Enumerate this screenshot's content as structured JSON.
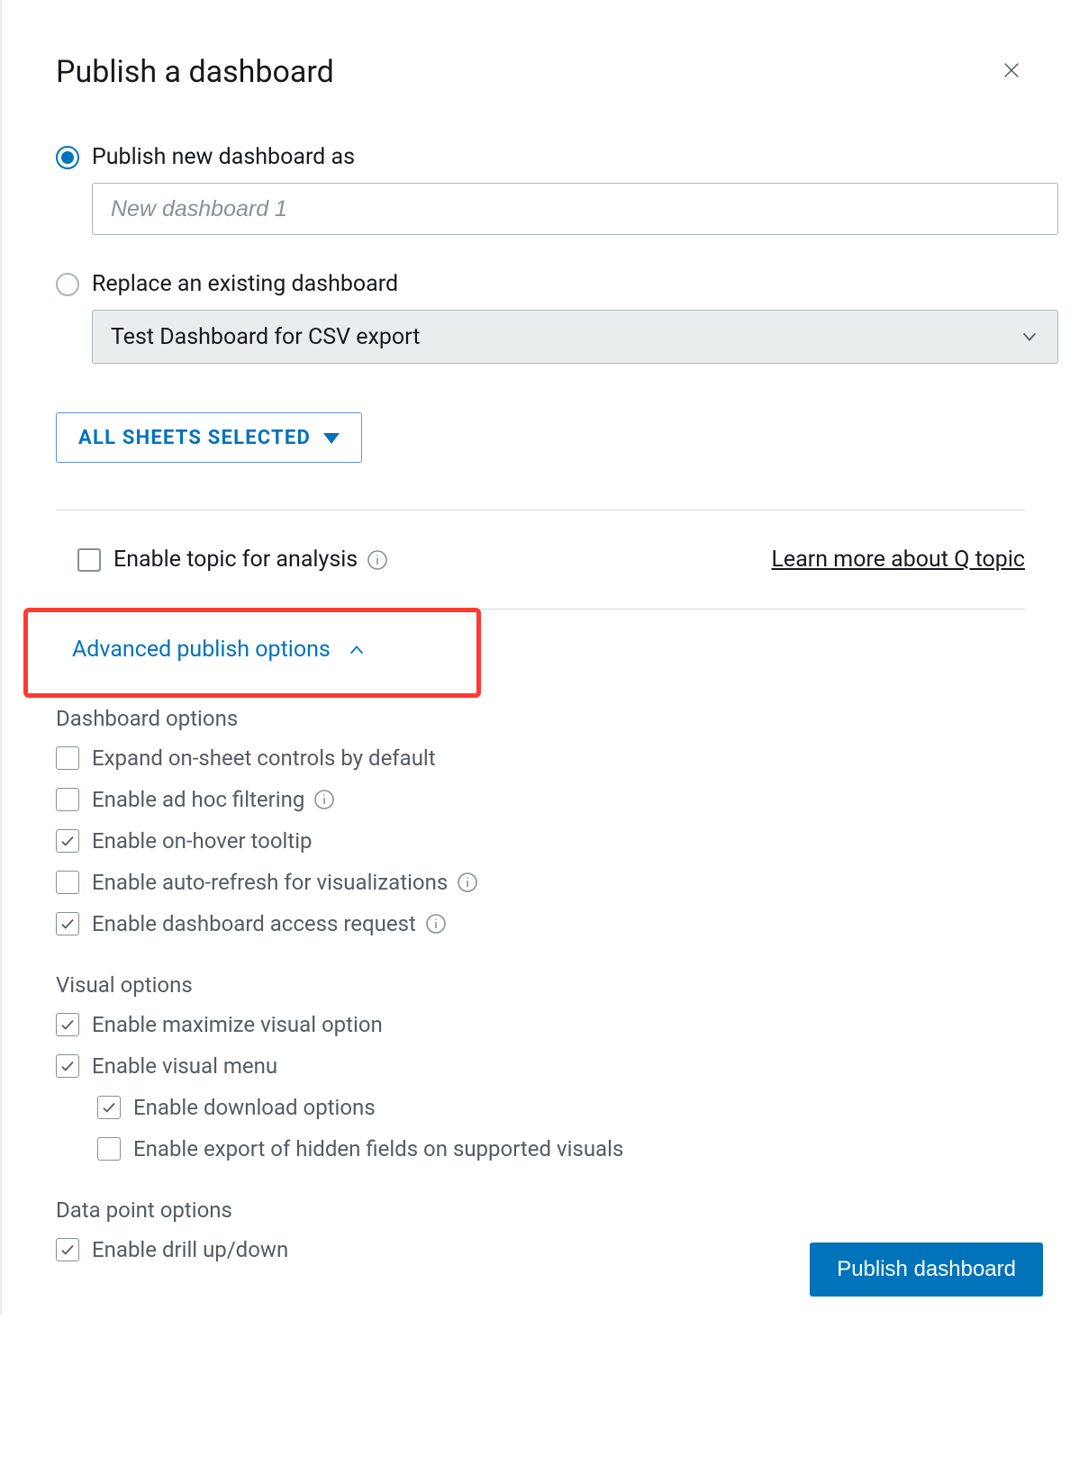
{
  "modal": {
    "title": "Publish a dashboard"
  },
  "publish_new": {
    "label": "Publish new dashboard as",
    "placeholder": "New dashboard 1",
    "selected": true
  },
  "replace_existing": {
    "label": "Replace an existing dashboard",
    "value": "Test Dashboard for CSV export",
    "selected": false
  },
  "sheets_button": "ALL SHEETS SELECTED",
  "topic": {
    "enable_label": "Enable topic for analysis",
    "learn_more": "Learn more about Q topic"
  },
  "advanced_toggle": "Advanced publish options",
  "sections": {
    "dashboard_options": {
      "heading": "Dashboard options",
      "items": [
        {
          "label": "Expand on-sheet controls by default",
          "checked": false,
          "info": false
        },
        {
          "label": "Enable ad hoc filtering",
          "checked": false,
          "info": true
        },
        {
          "label": "Enable on-hover tooltip",
          "checked": true,
          "info": false
        },
        {
          "label": "Enable auto-refresh for visualizations",
          "checked": false,
          "info": true
        },
        {
          "label": "Enable dashboard access request",
          "checked": true,
          "info": true
        }
      ]
    },
    "visual_options": {
      "heading": "Visual options",
      "items": [
        {
          "label": "Enable maximize visual option",
          "checked": true
        },
        {
          "label": "Enable visual menu",
          "checked": true
        }
      ],
      "sub_items": [
        {
          "label": "Enable download options",
          "checked": true
        },
        {
          "label": "Enable export of hidden fields on supported visuals",
          "checked": false
        }
      ]
    },
    "data_point_options": {
      "heading": "Data point options",
      "items": [
        {
          "label": "Enable drill up/down",
          "checked": true
        }
      ]
    }
  },
  "publish_button": "Publish dashboard"
}
